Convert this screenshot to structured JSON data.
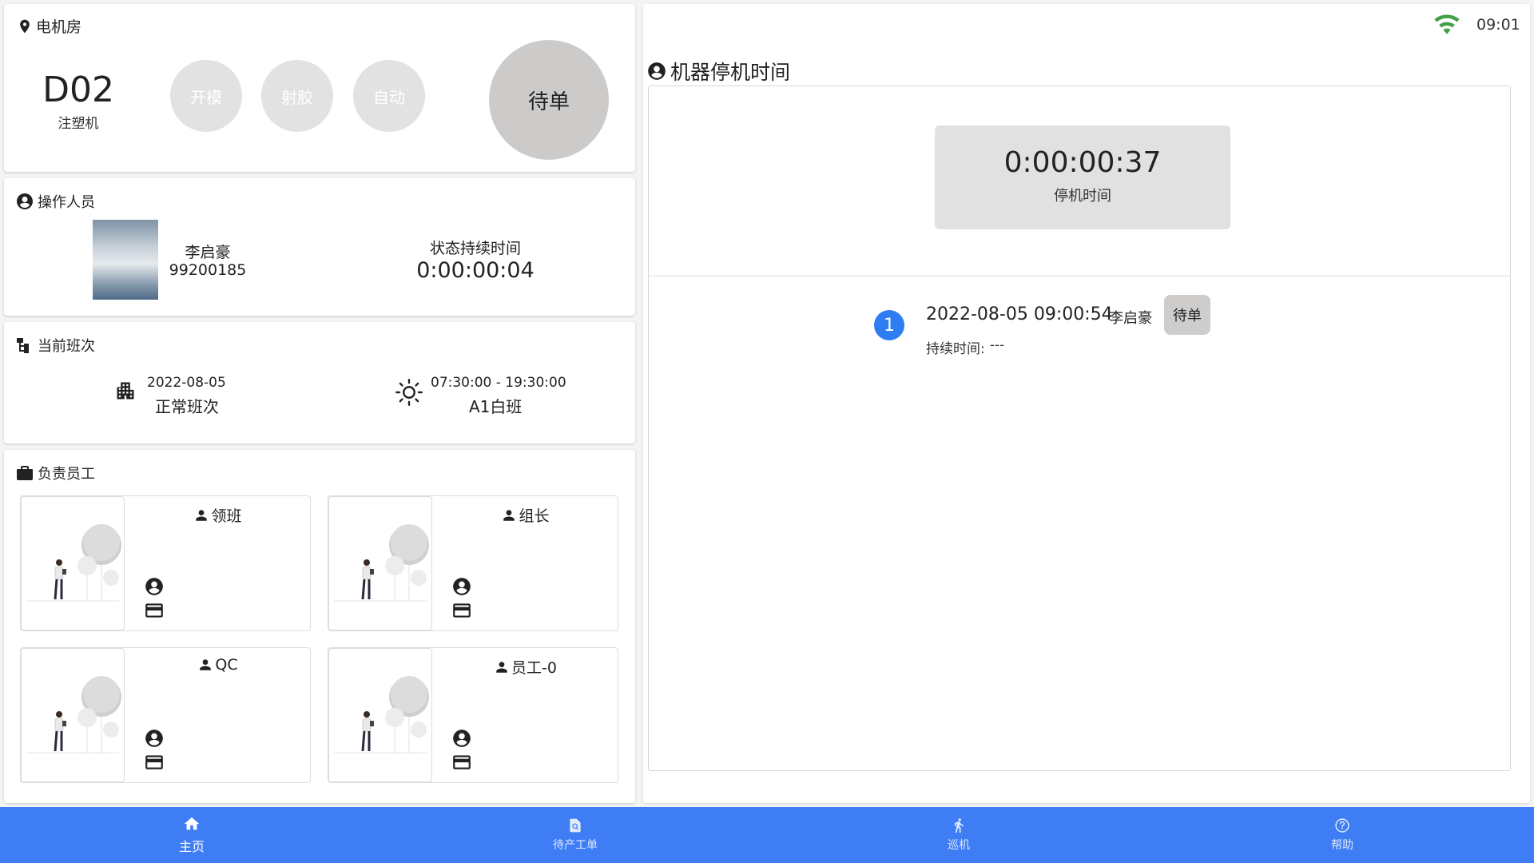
{
  "machine": {
    "location": "电机房",
    "code": "D02",
    "type": "注塑机",
    "state_buttons": [
      "开模",
      "射胶",
      "自动"
    ],
    "current_state": "待单"
  },
  "operator": {
    "section_title": "操作人员",
    "name": "李启豪",
    "id": "99200185",
    "duration_label": "状态持续时间",
    "duration_value": "0:00:00:04"
  },
  "shift": {
    "section_title": "当前班次",
    "date": "2022-08-05",
    "name": "正常班次",
    "time_range": "07:30:00 - 19:30:00",
    "class_name": "A1白班"
  },
  "staff": {
    "section_title": "负责员工",
    "roles": [
      "领班",
      "组长",
      "QC",
      "员工-0"
    ]
  },
  "downtime": {
    "title": "机器停机时间",
    "timer_value": "0:00:00:37",
    "timer_label": "停机时间",
    "events": [
      {
        "index": "1",
        "datetime": "2022-08-05 09:00:54",
        "operator": "李启豪",
        "state": "待单",
        "duration_label": "持续时间:",
        "duration_value": "---"
      }
    ]
  },
  "statusbar": {
    "time": "09:01"
  },
  "nav": {
    "items": [
      {
        "label": "主页",
        "icon": "home-icon",
        "active": true
      },
      {
        "label": "待产工单",
        "icon": "document-search-icon",
        "active": false
      },
      {
        "label": "巡机",
        "icon": "walking-icon",
        "active": false
      },
      {
        "label": "帮助",
        "icon": "help-icon",
        "active": false
      }
    ]
  },
  "colors": {
    "nav_bg": "#3f7df5",
    "event_badge": "#2f7df3",
    "wifi": "#43a047",
    "state_circle": "#cdcaca"
  }
}
